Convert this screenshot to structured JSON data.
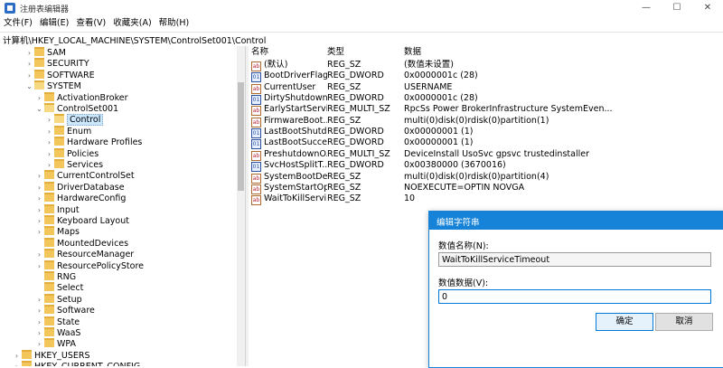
{
  "window": {
    "title": "注册表编辑器",
    "minimize": "—",
    "maximize": "☐",
    "close": "✕"
  },
  "menu": [
    "文件(F)",
    "编辑(E)",
    "查看(V)",
    "收藏夹(A)",
    "帮助(H)"
  ],
  "address": "计算机\\HKEY_LOCAL_MACHINE\\SYSTEM\\ControlSet001\\Control",
  "tree": [
    {
      "label": "SAM",
      "level": 0,
      "arrow": "›",
      "open": false
    },
    {
      "label": "SECURITY",
      "level": 0,
      "arrow": "›",
      "open": false
    },
    {
      "label": "SOFTWARE",
      "level": 0,
      "arrow": "›",
      "open": false
    },
    {
      "label": "SYSTEM",
      "level": 0,
      "arrow": "⌄",
      "open": true
    },
    {
      "label": "ActivationBroker",
      "level": 1,
      "arrow": "›",
      "open": false
    },
    {
      "label": "ControlSet001",
      "level": 1,
      "arrow": "⌄",
      "open": true
    },
    {
      "label": "Control",
      "level": 2,
      "arrow": "›",
      "open": true,
      "selected": true
    },
    {
      "label": "Enum",
      "level": 2,
      "arrow": "›",
      "open": false
    },
    {
      "label": "Hardware Profiles",
      "level": 2,
      "arrow": "›",
      "open": false
    },
    {
      "label": "Policies",
      "level": 2,
      "arrow": "›",
      "open": false
    },
    {
      "label": "Services",
      "level": 2,
      "arrow": "›",
      "open": false
    },
    {
      "label": "CurrentControlSet",
      "level": 1,
      "arrow": "›",
      "open": false
    },
    {
      "label": "DriverDatabase",
      "level": 1,
      "arrow": "›",
      "open": false
    },
    {
      "label": "HardwareConfig",
      "level": 1,
      "arrow": "›",
      "open": false
    },
    {
      "label": "Input",
      "level": 1,
      "arrow": "›",
      "open": false
    },
    {
      "label": "Keyboard Layout",
      "level": 1,
      "arrow": "›",
      "open": false
    },
    {
      "label": "Maps",
      "level": 1,
      "arrow": "›",
      "open": false
    },
    {
      "label": "MountedDevices",
      "level": 1,
      "arrow": "",
      "open": false
    },
    {
      "label": "ResourceManager",
      "level": 1,
      "arrow": "›",
      "open": false
    },
    {
      "label": "ResourcePolicyStore",
      "level": 1,
      "arrow": "›",
      "open": false
    },
    {
      "label": "RNG",
      "level": 1,
      "arrow": "",
      "open": false
    },
    {
      "label": "Select",
      "level": 1,
      "arrow": "",
      "open": false
    },
    {
      "label": "Setup",
      "level": 1,
      "arrow": "›",
      "open": false
    },
    {
      "label": "Software",
      "level": 1,
      "arrow": "›",
      "open": false
    },
    {
      "label": "State",
      "level": 1,
      "arrow": "›",
      "open": false
    },
    {
      "label": "WaaS",
      "level": 1,
      "arrow": "›",
      "open": false
    },
    {
      "label": "WPA",
      "level": 1,
      "arrow": "›",
      "open": false
    },
    {
      "label": "HKEY_USERS",
      "level": -1,
      "arrow": "›",
      "open": false
    },
    {
      "label": "HKEY_CURRENT_CONFIG",
      "level": -1,
      "arrow": "›",
      "open": false
    }
  ],
  "list": {
    "headers": {
      "name": "名称",
      "type": "类型",
      "data": "数据"
    },
    "rows": [
      {
        "icon": "ab",
        "name": "(默认)",
        "type": "REG_SZ",
        "data": "(数值未设置)"
      },
      {
        "icon": "bin",
        "name": "BootDriverFlags",
        "type": "REG_DWORD",
        "data": "0x0000001c (28)"
      },
      {
        "icon": "ab",
        "name": "CurrentUser",
        "type": "REG_SZ",
        "data": "USERNAME"
      },
      {
        "icon": "bin",
        "name": "DirtyShutdown...",
        "type": "REG_DWORD",
        "data": "0x0000001c (28)"
      },
      {
        "icon": "ab",
        "name": "EarlyStartServi...",
        "type": "REG_MULTI_SZ",
        "data": "RpcSs Power BrokerInfrastructure SystemEven..."
      },
      {
        "icon": "ab",
        "name": "FirmwareBoot...",
        "type": "REG_SZ",
        "data": "multi(0)disk(0)rdisk(0)partition(1)"
      },
      {
        "icon": "bin",
        "name": "LastBootShutd...",
        "type": "REG_DWORD",
        "data": "0x00000001 (1)"
      },
      {
        "icon": "bin",
        "name": "LastBootSucce...",
        "type": "REG_DWORD",
        "data": "0x00000001 (1)"
      },
      {
        "icon": "ab",
        "name": "PreshutdownO...",
        "type": "REG_MULTI_SZ",
        "data": "DeviceInstall UsoSvc gpsvc trustedinstaller"
      },
      {
        "icon": "bin",
        "name": "SvcHostSplitT...",
        "type": "REG_DWORD",
        "data": "0x00380000 (3670016)"
      },
      {
        "icon": "ab",
        "name": "SystemBootDe...",
        "type": "REG_SZ",
        "data": "multi(0)disk(0)rdisk(0)partition(4)"
      },
      {
        "icon": "ab",
        "name": "SystemStartOp...",
        "type": "REG_SZ",
        "data": " NOEXECUTE=OPTIN  NOVGA"
      },
      {
        "icon": "ab",
        "name": "WaitToKillServi...",
        "type": "REG_SZ",
        "data": "10"
      }
    ]
  },
  "dialog": {
    "title": "编辑字符串",
    "name_label": "数值名称(N):",
    "name_value": "WaitToKillServiceTimeout",
    "data_label": "数值数据(V):",
    "data_value": "0",
    "ok": "确定",
    "cancel": "取消"
  }
}
